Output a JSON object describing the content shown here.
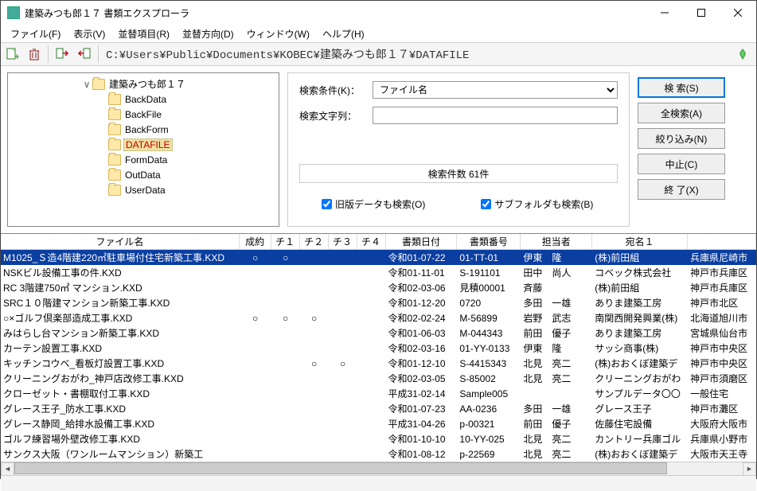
{
  "window": {
    "title": "建築みつも郎１７ 書類エクスプローラ"
  },
  "menu": {
    "file": "ファイル(F)",
    "view": "表示(V)",
    "sort_item": "並替項目(R)",
    "sort_dir": "並替方向(D)",
    "window": "ウィンドウ(W)",
    "help": "ヘルプ(H)"
  },
  "toolbar": {
    "path": "C:¥Users¥Public¥Documents¥KOBEC¥建築みつも郎１７¥DATAFILE"
  },
  "tree": {
    "root": "建築みつも郎１７",
    "children": [
      "BackData",
      "BackFile",
      "BackForm",
      "DATAFILE",
      "FormData",
      "OutData",
      "UserData"
    ],
    "selected": "DATAFILE"
  },
  "search": {
    "cond_label": "検索条件(K)：",
    "cond_value": "ファイル名",
    "text_label": "検索文字列：",
    "text_value": "",
    "count": "検索件数 61件",
    "old_ver": "旧版データも検索(O)",
    "subfolder": "サブフォルダも検索(B)"
  },
  "buttons": {
    "search": "検 索(S)",
    "all": "全検索(A)",
    "narrow": "絞り込み(N)",
    "stop": "中止(C)",
    "close": "終 了(X)"
  },
  "grid": {
    "headers": [
      "ファイル名",
      "成約",
      "チ１",
      "チ２",
      "チ３",
      "チ４",
      "書類日付",
      "書類番号",
      "担当者",
      "宛名１",
      ""
    ],
    "rows": [
      {
        "f": "M1025_Ｓ造4階建220㎡駐車場付住宅新築工事.KXD",
        "c": "○",
        "c1": "○",
        "c2": "",
        "c3": "",
        "c4": "",
        "d": "令和01-07-22",
        "n": "01-TT-01",
        "p": "伊東　隆",
        "a": "(株)前田組",
        "r": "兵庫県尼崎市",
        "sel": true
      },
      {
        "f": "NSKビル設備工事の件.KXD",
        "c": "",
        "c1": "",
        "c2": "",
        "c3": "",
        "c4": "",
        "d": "令和01-11-01",
        "n": "S-191101",
        "p": "田中　尚人",
        "a": "コベック株式会社",
        "r": "神戸市兵庫区"
      },
      {
        "f": "RC 3階建750㎡ マンション.KXD",
        "c": "",
        "c1": "",
        "c2": "",
        "c3": "",
        "c4": "",
        "d": "令和02-03-06",
        "n": "見積00001",
        "p": "斉藤",
        "a": "(株)前田組",
        "r": "神戸市兵庫区"
      },
      {
        "f": "SRC１０階建マンション新築工事.KXD",
        "c": "",
        "c1": "",
        "c2": "",
        "c3": "",
        "c4": "",
        "d": "令和01-12-20",
        "n": "0720",
        "p": "多田　一雄",
        "a": "ありま建築工房",
        "r": "神戸市北区"
      },
      {
        "f": "○×ゴルフ倶楽部造成工事.KXD",
        "c": "○",
        "c1": "○",
        "c2": "○",
        "c3": "",
        "c4": "",
        "d": "令和02-02-24",
        "n": "M-56899",
        "p": "岩野　武志",
        "a": "南関西開発興業(株)",
        "r": "北海道旭川市"
      },
      {
        "f": "みはらし台マンション新築工事.KXD",
        "c": "",
        "c1": "",
        "c2": "",
        "c3": "",
        "c4": "",
        "d": "令和01-06-03",
        "n": "M-044343",
        "p": "前田　優子",
        "a": "ありま建築工房",
        "r": "宮城県仙台市"
      },
      {
        "f": "カーテン設置工事.KXD",
        "c": "",
        "c1": "",
        "c2": "",
        "c3": "",
        "c4": "",
        "d": "令和02-03-16",
        "n": "01-YY-0133",
        "p": "伊東　隆",
        "a": "サッシ商事(株)",
        "r": "神戸市中央区"
      },
      {
        "f": "キッチンコウベ_看板灯設置工事.KXD",
        "c": "",
        "c1": "",
        "c2": "○",
        "c3": "○",
        "c4": "",
        "d": "令和01-12-10",
        "n": "S-4415343",
        "p": "北見　亮二",
        "a": "(株)おおくぼ建築デ",
        "r": "神戸市中央区"
      },
      {
        "f": "クリーニングおがわ_神戸店改修工事.KXD",
        "c": "",
        "c1": "",
        "c2": "",
        "c3": "",
        "c4": "",
        "d": "令和02-03-05",
        "n": "S-85002",
        "p": "北見　亮二",
        "a": "クリーニングおがわ",
        "r": "神戸市須磨区"
      },
      {
        "f": "クローゼット・書棚取付工事.KXD",
        "c": "",
        "c1": "",
        "c2": "",
        "c3": "",
        "c4": "",
        "d": "平成31-02-14",
        "n": "Sample005",
        "p": "",
        "a": "サンプルデータ〇〇",
        "r": "一般住宅"
      },
      {
        "f": "グレース王子_防水工事.KXD",
        "c": "",
        "c1": "",
        "c2": "",
        "c3": "",
        "c4": "",
        "d": "令和01-07-23",
        "n": "AA-0236",
        "p": "多田　一雄",
        "a": "グレース王子",
        "r": "神戸市灘区"
      },
      {
        "f": "グレース静岡_給排水設備工事.KXD",
        "c": "",
        "c1": "",
        "c2": "",
        "c3": "",
        "c4": "",
        "d": "平成31-04-26",
        "n": "p-00321",
        "p": "前田　優子",
        "a": "佐藤住宅設備",
        "r": "大阪府大阪市"
      },
      {
        "f": "ゴルフ練習場外壁改修工事.KXD",
        "c": "",
        "c1": "",
        "c2": "",
        "c3": "",
        "c4": "",
        "d": "令和01-10-10",
        "n": "10-YY-025",
        "p": "北見　亮二",
        "a": "カントリー兵庫ゴル",
        "r": "兵庫県小野市"
      },
      {
        "f": "サンクス大阪（ワンルームマンション）新築工",
        "c": "",
        "c1": "",
        "c2": "",
        "c3": "",
        "c4": "",
        "d": "令和01-08-12",
        "n": "p-22569",
        "p": "北見　亮二",
        "a": "(株)おおくぼ建築デ",
        "r": "大阪市天王寺"
      }
    ]
  }
}
